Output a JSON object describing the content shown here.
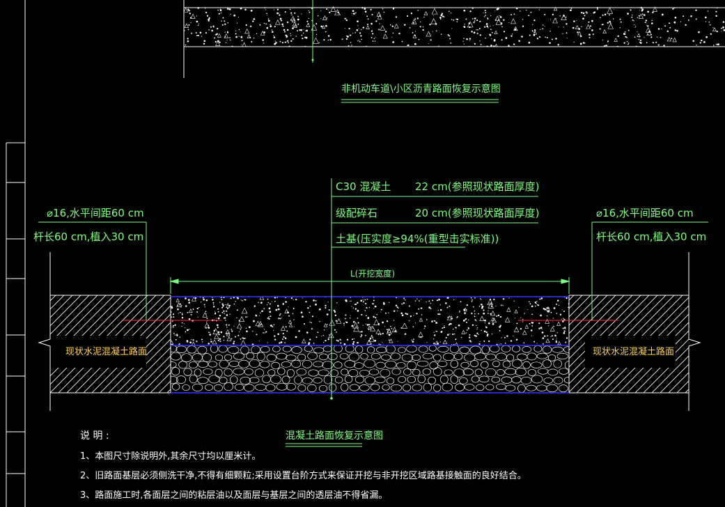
{
  "titles": {
    "top_title": "非机动车道\\小区沥青路面恢复示意图",
    "section_title": "混凝土路面恢复示意图"
  },
  "layers": [
    {
      "material": "C30 混凝土",
      "thickness": "22 cm(参照现状路面厚度)"
    },
    {
      "material": "级配碎石",
      "thickness": "20 cm(参照现状路面厚度)"
    },
    {
      "material": "土基(压实度≥94%(重型击实标准))",
      "thickness": ""
    }
  ],
  "rebar": {
    "left": {
      "line1": "⌀16,水平间距60 cm",
      "line2": "杆长60 cm,植入30 cm"
    },
    "right": {
      "line1": "⌀16,水平间距60 cm",
      "line2": "杆长60 cm,植入30 cm"
    }
  },
  "dimension": {
    "label": "L(开挖宽度)"
  },
  "existing_pavement": {
    "left": "现状水泥混凝土路面",
    "right": "现状水泥混凝土路面"
  },
  "notes": {
    "heading": "说 明 :",
    "items": [
      "1、本图尺寸除说明外,其余尺寸均以厘米计。",
      "2、旧路面基层必须侧洗干净,不得有细颗粒;采用设置台阶方式来保证开挖与非开挖区域路基接触面的良好结合。",
      "3、路面施工时,各面层之间的粘层油以及面层与基层之间的透层油不得省漏。"
    ]
  },
  "colors": {
    "background": "#000000",
    "annotation": "#7fff7f",
    "label": "#ffd24a",
    "layer_boundary": "#2a3cff",
    "rebar": "#ff3030",
    "linework": "#ffffff"
  }
}
